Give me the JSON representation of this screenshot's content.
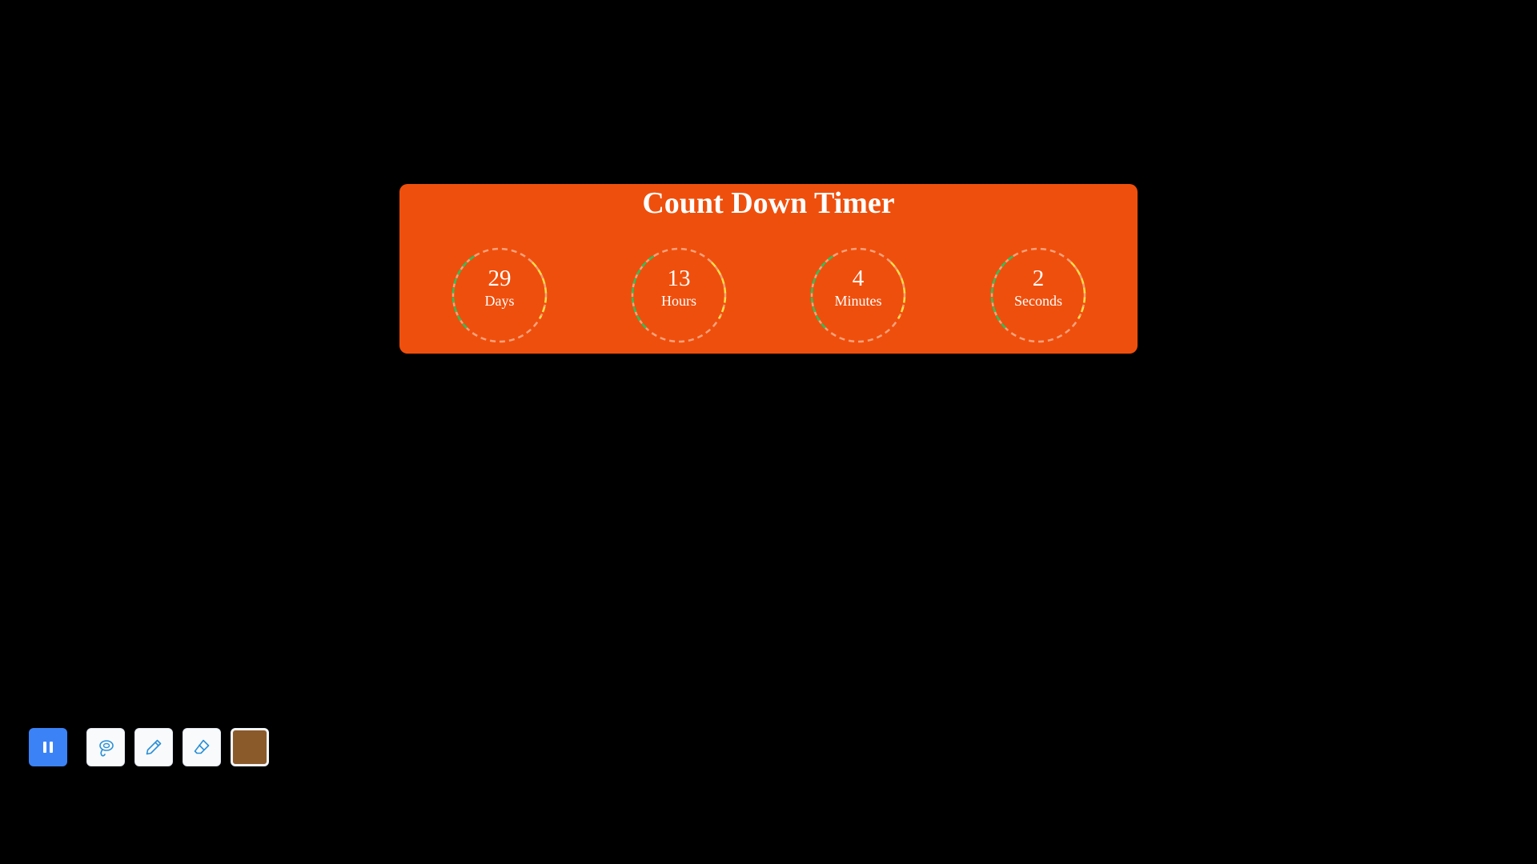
{
  "title": "Count Down Timer",
  "units": [
    {
      "value": "29",
      "label": "Days"
    },
    {
      "value": "13",
      "label": "Hours"
    },
    {
      "value": "4",
      "label": "Minutes"
    },
    {
      "value": "2",
      "label": "Seconds"
    }
  ],
  "colors": {
    "page_background": "#000000",
    "card_background": "#ef4f0c",
    "ring_green": "#22c55e",
    "ring_yellow": "#fde047",
    "ring_faint": "#f7a27d",
    "accent_button": "#3b82f6",
    "selected_color": "#8b5a2b"
  },
  "toolbar": {
    "pause_icon": "pause-icon",
    "lasso_icon": "lasso-icon",
    "pen_icon": "pencil-icon",
    "eraser_icon": "eraser-icon",
    "color_swatch": "#8b5a2b"
  }
}
